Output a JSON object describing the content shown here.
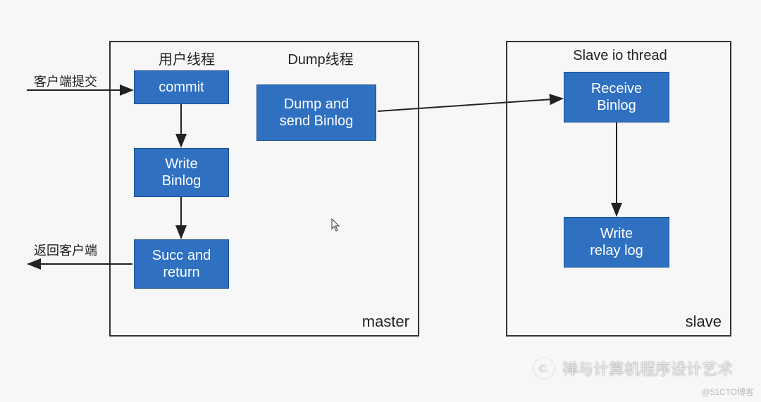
{
  "labels": {
    "client_submit": "客户端提交",
    "return_client": "返回客户端"
  },
  "master": {
    "frame_label": "master",
    "columns": {
      "user_thread": "用户线程",
      "dump_thread": "Dump线程"
    },
    "boxes": {
      "commit": "commit",
      "write_binlog": "Write\nBinlog",
      "succ_return": "Succ and\nreturn",
      "dump_send": "Dump and\nsend Binlog"
    }
  },
  "slave": {
    "frame_label": "slave",
    "columns": {
      "io_thread": "Slave io thread"
    },
    "boxes": {
      "receive_binlog": "Receive\nBinlog",
      "write_relay": "Write\nrelay log"
    }
  },
  "watermark": {
    "icon_text": "C.",
    "text": "禅与计算机程序设计艺术"
  },
  "footer": "@51CTO博客"
}
